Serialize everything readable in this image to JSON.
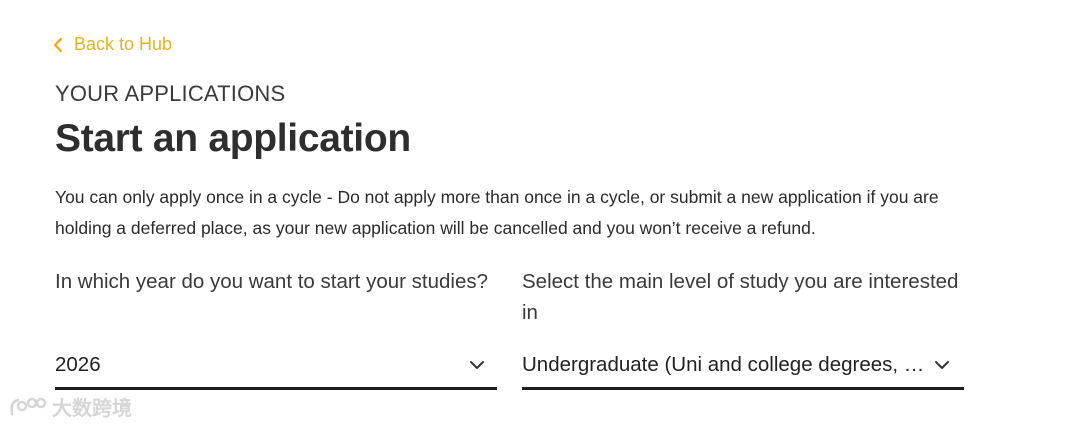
{
  "nav": {
    "back_label": "Back to Hub"
  },
  "header": {
    "eyebrow": "YOUR APPLICATIONS",
    "title": "Start an application"
  },
  "intro": {
    "text": "You can only apply once in a cycle - Do not apply more than once in a cycle, or submit a new application if you are holding a deferred place, as your new application will be cancelled and you won’t receive a refund."
  },
  "form": {
    "year": {
      "label": "In which year do you want to start your studies?",
      "value": "2026"
    },
    "level": {
      "label": "Select the main level of study you are interested in",
      "value": "Undergraduate (Uni and college degrees, and more)"
    }
  },
  "watermark": {
    "text": "大数跨境"
  },
  "colors": {
    "accent": "#e8b21f",
    "text": "#2b2b2b",
    "underline": "#1f1f1f"
  }
}
